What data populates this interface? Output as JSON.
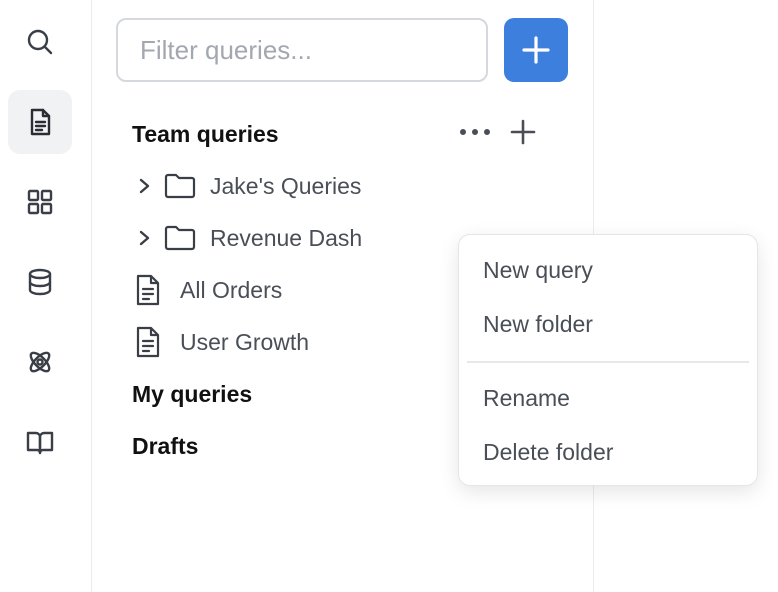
{
  "search": {
    "placeholder": "Filter queries..."
  },
  "sidebar_icons": [
    "search-icon",
    "document-icon",
    "grid-icon",
    "database-icon",
    "atom-icon",
    "book-icon"
  ],
  "active_icon": "document-icon",
  "colors": {
    "accent": "#3c7fdc",
    "active_bg": "#f1f2f4",
    "border": "#d5d8dd"
  },
  "sections": {
    "team": "Team queries",
    "mine": "My queries",
    "drafts": "Drafts"
  },
  "folders": [
    {
      "label": "Jake's Queries"
    },
    {
      "label": "Revenue Dash"
    }
  ],
  "queries": [
    {
      "label": "All Orders"
    },
    {
      "label": "User Growth"
    }
  ],
  "menu": {
    "new_query": "New query",
    "new_folder": "New folder",
    "rename": "Rename",
    "delete_folder": "Delete folder"
  }
}
